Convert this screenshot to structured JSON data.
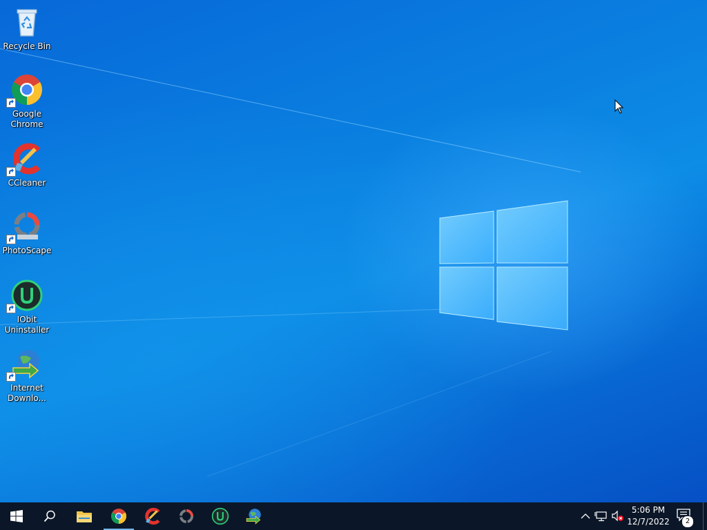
{
  "desktop": {
    "icons": [
      {
        "label": "Recycle Bin",
        "icon": "recycle-bin-icon"
      },
      {
        "label": "Google\nChrome",
        "icon": "chrome-icon"
      },
      {
        "label": "CCleaner",
        "icon": "ccleaner-icon"
      },
      {
        "label": "PhotoScape",
        "icon": "photoscape-icon"
      },
      {
        "label": "IObit\nUninstaller",
        "icon": "iobit-uninstaller-icon"
      },
      {
        "label": "Internet\nDownlo...",
        "icon": "internet-download-manager-icon"
      }
    ]
  },
  "taskbar": {
    "start": "windows-start-icon",
    "search": "search-icon",
    "pinned": [
      {
        "name": "file-explorer",
        "icon": "folder-icon"
      },
      {
        "name": "google-chrome",
        "icon": "chrome-icon",
        "active": true
      },
      {
        "name": "ccleaner",
        "icon": "ccleaner-icon"
      },
      {
        "name": "photoscape",
        "icon": "photoscape-icon"
      },
      {
        "name": "iobit-uninstaller",
        "icon": "iobit-uninstaller-icon"
      },
      {
        "name": "internet-download-manager",
        "icon": "internet-download-manager-icon"
      }
    ],
    "tray": {
      "chevron": "chevron-up-icon",
      "network": "network-disconnected-icon",
      "volume": "volume-muted-icon",
      "time": "5:06 PM",
      "date": "12/7/2022",
      "notifications_count": "2"
    }
  },
  "colors": {
    "taskbar_bg": "#0b1728",
    "desktop_blue": "#0a7fe0",
    "active_indicator": "#76b9ed"
  }
}
